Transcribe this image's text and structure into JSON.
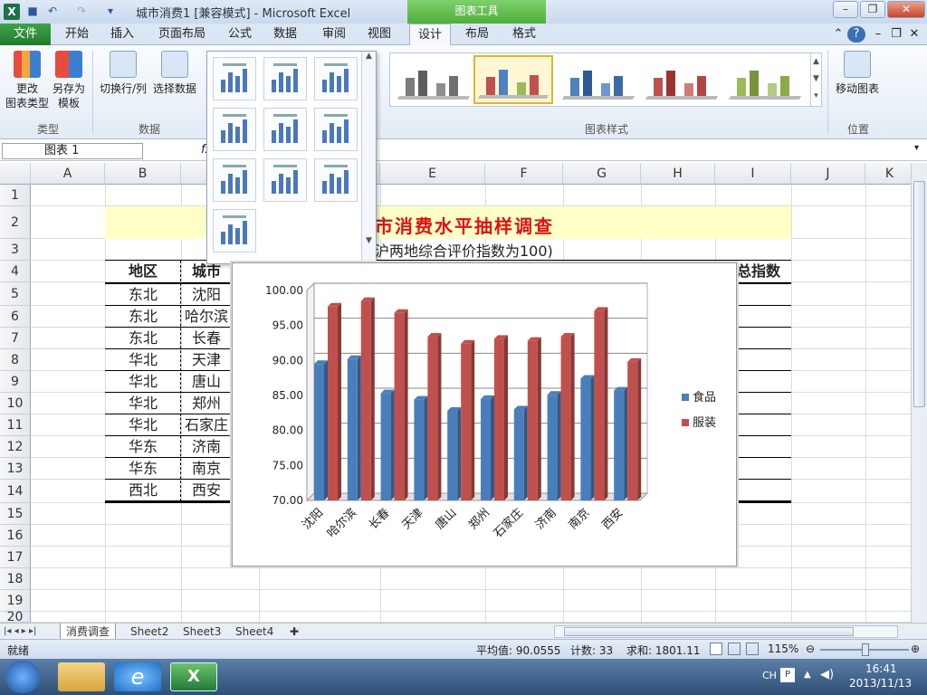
{
  "window": {
    "title": "城市消费1  [兼容模式] - Microsoft Excel",
    "context_tab": "图表工具"
  },
  "quick_access": {
    "icons": [
      "save-icon",
      "undo-icon",
      "redo-icon"
    ]
  },
  "ribbon_tabs": [
    {
      "label": "文件"
    },
    {
      "label": "开始"
    },
    {
      "label": "插入"
    },
    {
      "label": "页面布局"
    },
    {
      "label": "公式"
    },
    {
      "label": "数据"
    },
    {
      "label": "审阅"
    },
    {
      "label": "视图"
    },
    {
      "label": "设计"
    },
    {
      "label": "布局"
    },
    {
      "label": "格式"
    }
  ],
  "ribbon": {
    "change_type": "更改\n图表类型",
    "save_template": "另存为\n模板",
    "switch_rowcol": "切换行/列",
    "select_data": "选择数据",
    "move_chart": "移动图表",
    "group_type": "类型",
    "group_data": "数据",
    "group_styles": "图表样式",
    "group_location": "位置"
  },
  "formula_bar": {
    "name_box": "图表 1",
    "fx": "fx"
  },
  "columns": [
    "A",
    "B",
    "C",
    "D",
    "E",
    "F",
    "G",
    "H",
    "I",
    "J",
    "K"
  ],
  "rows": [
    "1",
    "2",
    "3",
    "4",
    "5",
    "6",
    "7",
    "8",
    "9",
    "10",
    "11",
    "12",
    "13",
    "14",
    "15",
    "16",
    "17",
    "18",
    "19",
    "20"
  ],
  "sheet": {
    "title_fragment": "市消费水平抽样调查",
    "subtitle_fragment": "沪两地综合评价指数为100)",
    "header_region": "地区",
    "header_city": "城市",
    "header_total": "总指数",
    "regions": [
      "东北",
      "东北",
      "东北",
      "华北",
      "华北",
      "华北",
      "华北",
      "华东",
      "华东",
      "西北"
    ],
    "cities": [
      "沈阳",
      "哈尔滨",
      "长春",
      "天津",
      "唐山",
      "郑州",
      "石家庄",
      "济南",
      "南京",
      "西安"
    ]
  },
  "chart_data": {
    "type": "bar",
    "categories": [
      "沈阳",
      "哈尔滨",
      "长春",
      "天津",
      "唐山",
      "郑州",
      "石家庄",
      "济南",
      "南京",
      "西安"
    ],
    "series": [
      {
        "name": "食品",
        "values": [
          89.5,
          90.2,
          85.3,
          84.4,
          82.8,
          84.5,
          83.0,
          85.1,
          87.4,
          85.7
        ]
      },
      {
        "name": "服装",
        "values": [
          97.7,
          98.5,
          96.8,
          93.4,
          92.4,
          93.1,
          92.8,
          93.4,
          97.1,
          89.8
        ]
      }
    ],
    "ylim": [
      70,
      100
    ],
    "yticks": [
      "100.00",
      "95.00",
      "90.00",
      "85.00",
      "80.00",
      "75.00",
      "70.00"
    ],
    "legend": "right",
    "colors": {
      "食品": "#4a7ebb",
      "服装": "#c0504d"
    }
  },
  "sheet_tabs": [
    "消费调查",
    "Sheet2",
    "Sheet3",
    "Sheet4"
  ],
  "status": {
    "ready": "就绪",
    "average": "平均值: 90.0555",
    "count": "计数: 33",
    "sum": "求和: 1801.11",
    "zoom": "115%"
  },
  "taskbar": {
    "lang": "CH",
    "time": "16:41",
    "date": "2013/11/13"
  }
}
